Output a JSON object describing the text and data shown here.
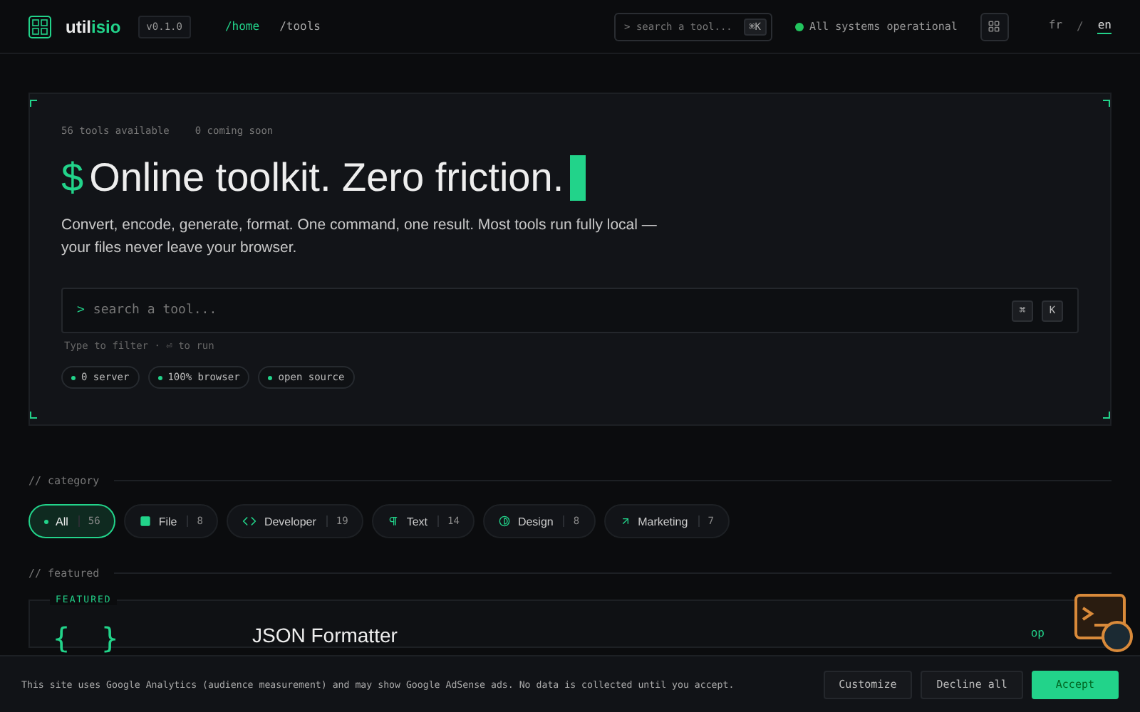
{
  "header": {
    "logo_text": "util",
    "logo_accent": "isio",
    "version": "v0.1.0",
    "nav": [
      {
        "label": "/home",
        "selected": true
      },
      {
        "label": "/tools",
        "selected": false
      }
    ],
    "search": {
      "placeholder": "> search a tool...",
      "shortcut": "⌘K"
    },
    "status": {
      "text": "All systems operational",
      "color": "#22c55e"
    },
    "languages": [
      {
        "label": "fr",
        "selected": false
      },
      {
        "label": "en",
        "selected": true
      }
    ],
    "lang_separator": "/"
  },
  "hero": {
    "meta": [
      "56 tools available",
      "0 coming soon"
    ],
    "prompt": "$",
    "title": "Online toolkit. Zero friction.",
    "description": "Convert, encode, generate, format. One command, one result. Most tools run fully local — your files never leave your browser.",
    "search": {
      "prompt": ">",
      "placeholder": "search a tool...",
      "keys": [
        "⌘",
        "K"
      ]
    },
    "hint": "Type to filter · ⏎ to run",
    "badges": [
      "0 server",
      "100% browser",
      "open source"
    ]
  },
  "category": {
    "heading": "// category",
    "items": [
      {
        "label": "All",
        "count": "56",
        "kind": "all",
        "selected": true
      },
      {
        "label": "File",
        "count": "8",
        "kind": "file",
        "selected": false
      },
      {
        "label": "Developer",
        "count": "19",
        "kind": "developer",
        "selected": false
      },
      {
        "label": "Text",
        "count": "14",
        "kind": "text",
        "selected": false
      },
      {
        "label": "Design",
        "count": "8",
        "kind": "design",
        "selected": false
      },
      {
        "label": "Marketing",
        "count": "7",
        "kind": "marketing",
        "selected": false
      }
    ]
  },
  "featured": {
    "heading": "// featured",
    "tag": "FEATURED",
    "glyph": "{ }",
    "title": "JSON Formatter",
    "link": "op"
  },
  "cookie": {
    "text": "This site uses Google Analytics (audience measurement) and may show Google AdSense ads. No data is collected until you accept.",
    "buttons": [
      {
        "label": "Customize",
        "kind": "secondary"
      },
      {
        "label": "Decline all",
        "kind": "secondary"
      },
      {
        "label": "Accept",
        "kind": "primary"
      }
    ]
  }
}
